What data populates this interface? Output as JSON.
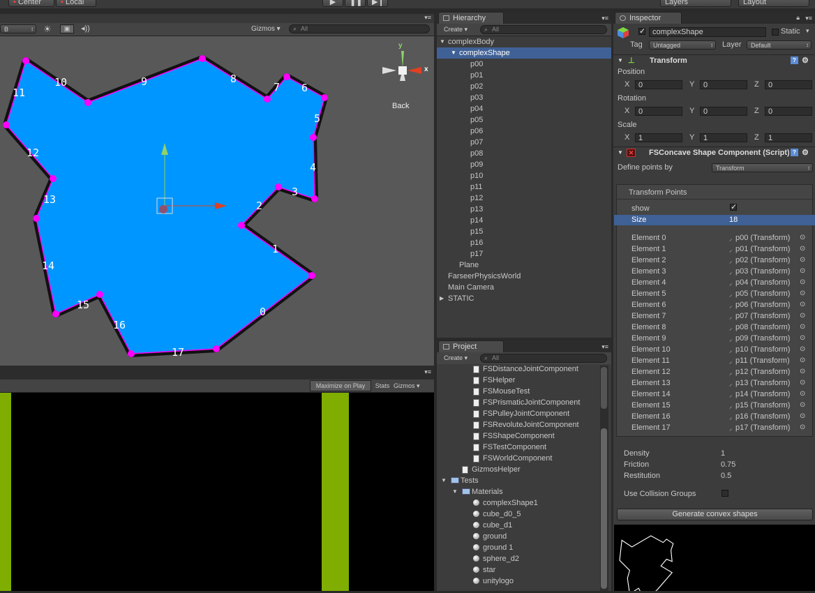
{
  "toolbar": {
    "pivot_label": "Center",
    "space_label": "Local",
    "layers_label": "Layers",
    "layout_label": "Layout"
  },
  "scene": {
    "shading_mode": "B",
    "gizmos_label": "Gizmos",
    "search_placeholder": "All",
    "view_label": "Back",
    "axis_y": "y",
    "axis_x": "x",
    "shape_fill": "#0096ff",
    "vertex_color": "#ff00ff",
    "edge_labels": [
      "0",
      "1",
      "2",
      "3",
      "4",
      "5",
      "6",
      "7",
      "8",
      "9",
      "10",
      "11",
      "12",
      "13",
      "14",
      "15",
      "16",
      "17"
    ]
  },
  "game": {
    "maximize_label": "Maximize on Play",
    "stats_label": "Stats",
    "gizmos_label": "Gizmos",
    "side_color": "#7fae00",
    "shape_fill": "#0096ff"
  },
  "hierarchy": {
    "title": "Hierarchy",
    "create_label": "Create",
    "search_placeholder": "All",
    "items": [
      {
        "label": "complexBody",
        "arrow": "▼"
      },
      {
        "label": "complexShape",
        "arrow": "▼"
      },
      {
        "label": "p00",
        "arrow": ""
      },
      {
        "label": "p01",
        "arrow": ""
      },
      {
        "label": "p02",
        "arrow": ""
      },
      {
        "label": "p03",
        "arrow": ""
      },
      {
        "label": "p04",
        "arrow": ""
      },
      {
        "label": "p05",
        "arrow": ""
      },
      {
        "label": "p06",
        "arrow": ""
      },
      {
        "label": "p07",
        "arrow": ""
      },
      {
        "label": "p08",
        "arrow": ""
      },
      {
        "label": "p09",
        "arrow": ""
      },
      {
        "label": "p10",
        "arrow": ""
      },
      {
        "label": "p11",
        "arrow": ""
      },
      {
        "label": "p12",
        "arrow": ""
      },
      {
        "label": "p13",
        "arrow": ""
      },
      {
        "label": "p14",
        "arrow": ""
      },
      {
        "label": "p15",
        "arrow": ""
      },
      {
        "label": "p16",
        "arrow": ""
      },
      {
        "label": "p17",
        "arrow": ""
      },
      {
        "label": "Plane",
        "arrow": ""
      },
      {
        "label": "FarseerPhysicsWorld",
        "arrow": ""
      },
      {
        "label": "Main Camera",
        "arrow": ""
      },
      {
        "label": "STATIC",
        "arrow": "▶"
      }
    ]
  },
  "project": {
    "title": "Project",
    "create_label": "Create",
    "search_placeholder": "All",
    "scripts": [
      "FSDistanceJointComponent",
      "FSHelper",
      "FSMouseTest",
      "FSPrismaticJointComponent",
      "FSPulleyJointComponent",
      "FSRevoluteJointComponent",
      "FSShapeComponent",
      "FSTestComponent",
      "FSWorldComponent"
    ],
    "gizmos_helper": "GizmosHelper",
    "tests_folder": "Tests",
    "materials_folder": "Materials",
    "materials": [
      "complexShape1",
      "cube_d0_5",
      "cube_d1",
      "ground",
      "ground 1",
      "sphere_d2",
      "star",
      "unitylogo"
    ]
  },
  "inspector": {
    "title": "Inspector",
    "object_name": "complexShape",
    "static_label": "Static",
    "tag_label": "Tag",
    "tag_value": "Untagged",
    "layer_label": "Layer",
    "layer_value": "Default",
    "transform": {
      "title": "Transform",
      "position_label": "Position",
      "rotation_label": "Rotation",
      "scale_label": "Scale",
      "x_label": "X",
      "y_label": "Y",
      "z_label": "Z",
      "position": [
        "0",
        "0",
        "0"
      ],
      "rotation": [
        "0",
        "0",
        "0"
      ],
      "scale": [
        "1",
        "1",
        "1"
      ]
    },
    "component": {
      "title": "FSConcave Shape Component (Script)",
      "define_label": "Define points by",
      "define_value": "Transform",
      "points_header": "Transform Points",
      "show_label": "show",
      "size_label": "Size",
      "size_value": "18",
      "elements": [
        {
          "label": "Element 0",
          "value": "p00 (Transform)"
        },
        {
          "label": "Element 1",
          "value": "p01 (Transform)"
        },
        {
          "label": "Element 2",
          "value": "p02 (Transform)"
        },
        {
          "label": "Element 3",
          "value": "p03 (Transform)"
        },
        {
          "label": "Element 4",
          "value": "p04 (Transform)"
        },
        {
          "label": "Element 5",
          "value": "p05 (Transform)"
        },
        {
          "label": "Element 6",
          "value": "p06 (Transform)"
        },
        {
          "label": "Element 7",
          "value": "p07 (Transform)"
        },
        {
          "label": "Element 8",
          "value": "p08 (Transform)"
        },
        {
          "label": "Element 9",
          "value": "p09 (Transform)"
        },
        {
          "label": "Element 10",
          "value": "p10 (Transform)"
        },
        {
          "label": "Element 11",
          "value": "p11 (Transform)"
        },
        {
          "label": "Element 12",
          "value": "p12 (Transform)"
        },
        {
          "label": "Element 13",
          "value": "p13 (Transform)"
        },
        {
          "label": "Element 14",
          "value": "p14 (Transform)"
        },
        {
          "label": "Element 15",
          "value": "p15 (Transform)"
        },
        {
          "label": "Element 16",
          "value": "p16 (Transform)"
        },
        {
          "label": "Element 17",
          "value": "p17 (Transform)"
        }
      ],
      "density_label": "Density",
      "density_value": "1",
      "friction_label": "Friction",
      "friction_value": "0.75",
      "restitution_label": "Restitution",
      "restitution_value": "0.5",
      "collision_label": "Use Collision Groups",
      "generate_label": "Generate convex shapes"
    }
  }
}
